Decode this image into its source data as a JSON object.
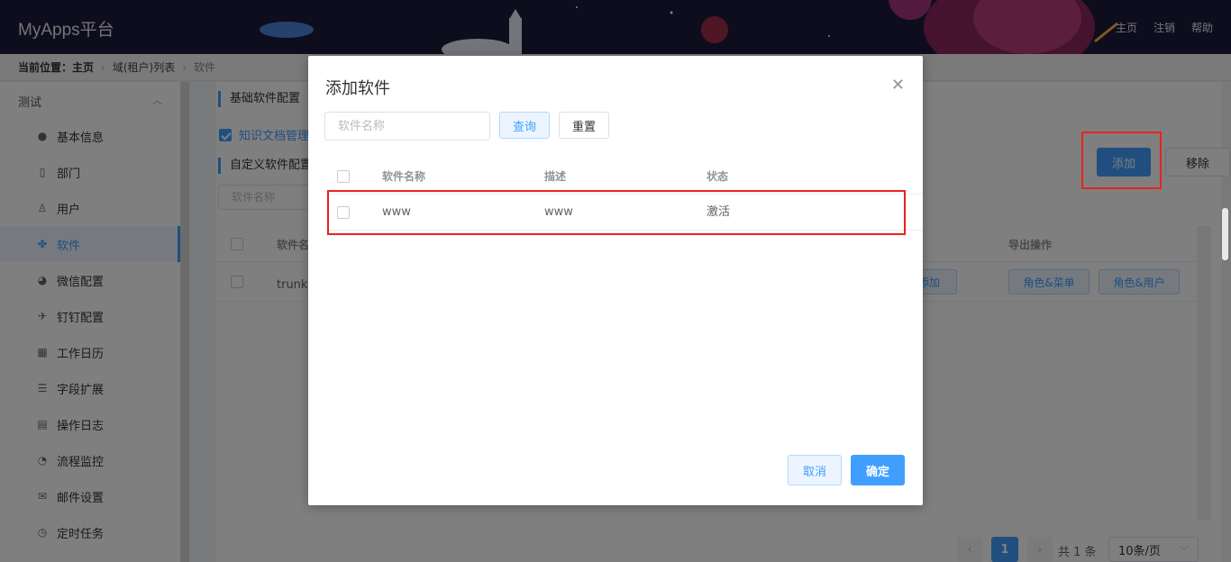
{
  "header": {
    "brand": "MyApps平台",
    "nav": [
      "主页",
      "注销",
      "帮助"
    ]
  },
  "breadcrumb": {
    "label": "当前位置：主页",
    "items": [
      "域(租户)列表",
      "软件"
    ]
  },
  "sidebar": {
    "group": "测试",
    "items": [
      {
        "label": "基本信息",
        "icon": "info-circle-icon"
      },
      {
        "label": "部门",
        "icon": "building-icon"
      },
      {
        "label": "用户",
        "icon": "user-icon"
      },
      {
        "label": "软件",
        "icon": "cubes-icon",
        "active": true
      },
      {
        "label": "微信配置",
        "icon": "wechat-icon"
      },
      {
        "label": "钉钉配置",
        "icon": "plane-icon"
      },
      {
        "label": "工作日历",
        "icon": "calendar-icon"
      },
      {
        "label": "字段扩展",
        "icon": "sliders-icon"
      },
      {
        "label": "操作日志",
        "icon": "log-icon"
      },
      {
        "label": "流程监控",
        "icon": "dashboard-icon"
      },
      {
        "label": "邮件设置",
        "icon": "mail-icon"
      },
      {
        "label": "定时任务",
        "icon": "clock-icon"
      }
    ]
  },
  "main": {
    "section_base": "基础软件配置",
    "base_checked_item": "知识文档管理",
    "section_custom": "自定义软件配置",
    "search_placeholder": "软件名称",
    "add_button": "添加",
    "remove_button": "移除",
    "table_col_name": "软件名",
    "table_col_export": "导出操作",
    "row_name": "trunk工",
    "row_add_button": "添加",
    "row_role_menu_button": "角色&菜单",
    "row_role_user_button": "角色&用户",
    "pagination": {
      "page": "1",
      "total": "共 1 条",
      "page_size": "10条/页"
    }
  },
  "modal": {
    "title": "添加软件",
    "search_placeholder": "软件名称",
    "query_button": "查询",
    "reset_button": "重置",
    "columns": [
      "软件名称",
      "描述",
      "状态"
    ],
    "rows": [
      {
        "name": "www",
        "desc": "www",
        "status": "激活"
      }
    ],
    "cancel_button": "取消",
    "confirm_button": "确定"
  },
  "colors": {
    "primary": "#409eff",
    "highlight": "#e8231d",
    "header_bg": "#1d1b3d"
  }
}
